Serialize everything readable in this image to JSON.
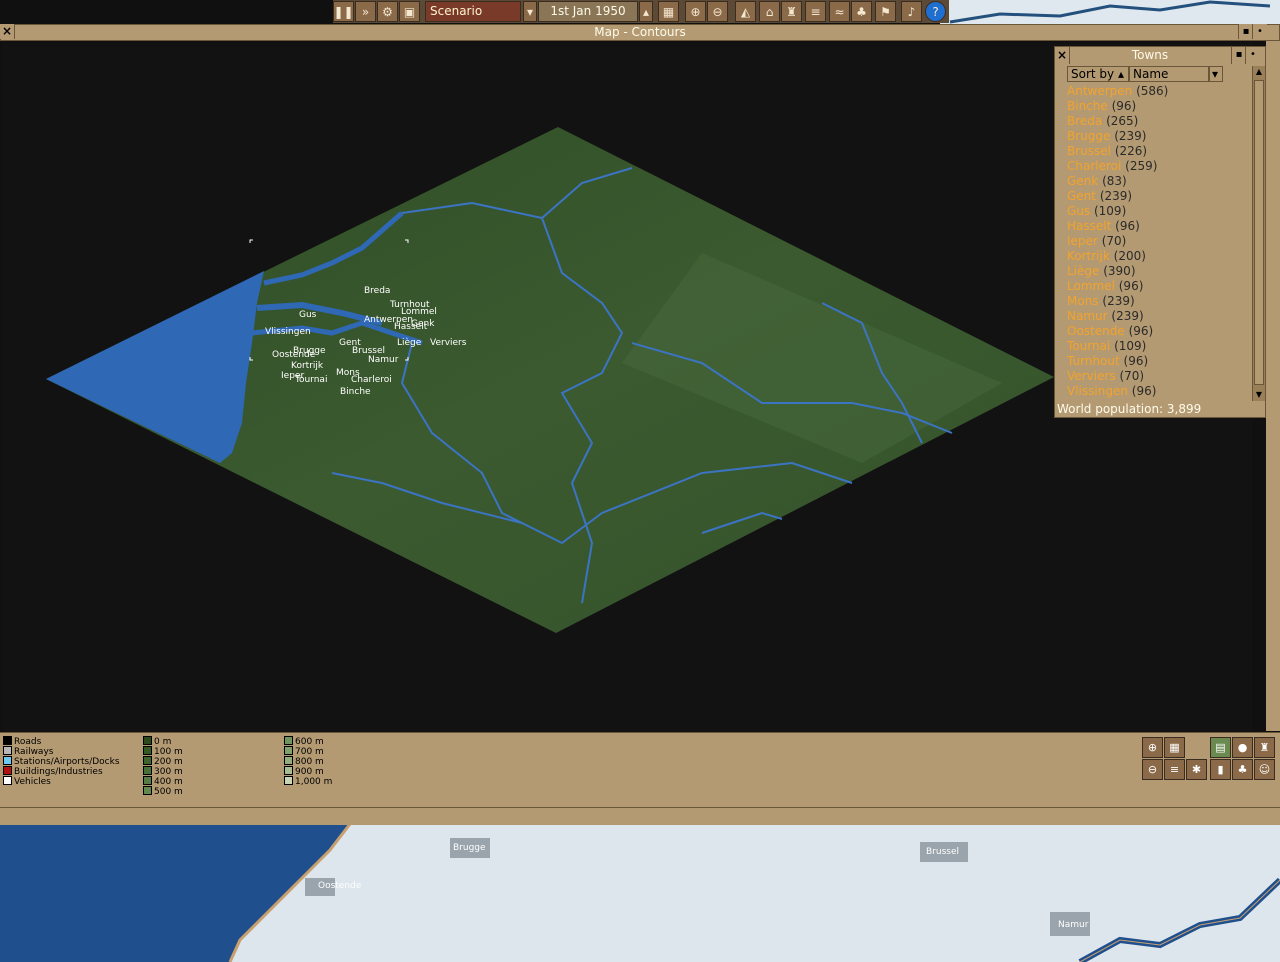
{
  "toolbar": {
    "mode_label": "Scenario Editor",
    "date": "1st Jan 1950",
    "buttons": [
      {
        "icon": "pause-icon"
      },
      {
        "icon": "fast-forward-icon"
      },
      {
        "icon": "settings-gear-icon"
      },
      {
        "icon": "save-icon"
      },
      {
        "icon": "minimap-icon"
      },
      {
        "icon": "zoom-in-icon"
      },
      {
        "icon": "zoom-out-icon"
      },
      {
        "icon": "landscaping-icon"
      },
      {
        "icon": "town-icon"
      },
      {
        "icon": "industry-icon"
      },
      {
        "icon": "rail-icon"
      },
      {
        "icon": "water-icon"
      },
      {
        "icon": "trees-icon"
      },
      {
        "icon": "sign-icon"
      },
      {
        "icon": "sound-icon"
      },
      {
        "icon": "help-icon"
      }
    ]
  },
  "map_window": {
    "title": "Map - Contours",
    "town_labels": [
      {
        "name": "Breda"
      },
      {
        "name": "Turnhout"
      },
      {
        "name": "Gus"
      },
      {
        "name": "Lommel"
      },
      {
        "name": "Antwerpen"
      },
      {
        "name": "Hasselt"
      },
      {
        "name": "Genk"
      },
      {
        "name": "Vlissingen"
      },
      {
        "name": "Gent"
      },
      {
        "name": "Liège"
      },
      {
        "name": "Verviers"
      },
      {
        "name": "Brugge"
      },
      {
        "name": "Oostende"
      },
      {
        "name": "Brussel"
      },
      {
        "name": "Namur"
      },
      {
        "name": "Kortrijk"
      },
      {
        "name": "Ieper"
      },
      {
        "name": "Mons"
      },
      {
        "name": "Tournai"
      },
      {
        "name": "Charleroi"
      },
      {
        "name": "Binche"
      }
    ],
    "legend": {
      "categories": [
        {
          "label": "Roads",
          "color": "#000000"
        },
        {
          "label": "Railways",
          "color": "#b8b8b8"
        },
        {
          "label": "Stations/Airports/Docks",
          "color": "#6ec8f0"
        },
        {
          "label": "Buildings/Industries",
          "color": "#b01010"
        },
        {
          "label": "Vehicles",
          "color": "#ffffff"
        }
      ],
      "heights_col1": [
        {
          "label": "0 m",
          "color": "#2a4a1c"
        },
        {
          "label": "100 m",
          "color": "#345826"
        },
        {
          "label": "200 m",
          "color": "#3e6430"
        },
        {
          "label": "300 m",
          "color": "#48703a"
        },
        {
          "label": "400 m",
          "color": "#557c46"
        },
        {
          "label": "500 m",
          "color": "#628852"
        }
      ],
      "heights_col2": [
        {
          "label": "600 m",
          "color": "#70945e"
        },
        {
          "label": "700 m",
          "color": "#80a06c"
        },
        {
          "label": "800 m",
          "color": "#92ac7c"
        },
        {
          "label": "900 m",
          "color": "#a8bc92"
        },
        {
          "label": "1,000 m",
          "color": "#c8d4b4"
        }
      ]
    }
  },
  "towns_window": {
    "title": "Towns",
    "sort_by_label": "Sort by",
    "sort_field": "Name",
    "towns": [
      {
        "name": "Antwerpen",
        "pop": "(586)"
      },
      {
        "name": "Binche",
        "pop": "(96)"
      },
      {
        "name": "Breda",
        "pop": "(265)"
      },
      {
        "name": "Brugge",
        "pop": "(239)"
      },
      {
        "name": "Brussel",
        "pop": "(226)"
      },
      {
        "name": "Charleroi",
        "pop": "(259)"
      },
      {
        "name": "Genk",
        "pop": "(83)"
      },
      {
        "name": "Gent",
        "pop": "(239)"
      },
      {
        "name": "Gus",
        "pop": "(109)"
      },
      {
        "name": "Hasselt",
        "pop": "(96)"
      },
      {
        "name": "Ieper",
        "pop": "(70)"
      },
      {
        "name": "Kortrijk",
        "pop": "(200)"
      },
      {
        "name": "Liège",
        "pop": "(390)"
      },
      {
        "name": "Lommel",
        "pop": "(96)"
      },
      {
        "name": "Mons",
        "pop": "(239)"
      },
      {
        "name": "Namur",
        "pop": "(239)"
      },
      {
        "name": "Oostende",
        "pop": "(96)"
      },
      {
        "name": "Tournai",
        "pop": "(109)"
      },
      {
        "name": "Turnhout",
        "pop": "(96)"
      },
      {
        "name": "Verviers",
        "pop": "(70)"
      },
      {
        "name": "Vlissingen",
        "pop": "(96)"
      }
    ],
    "world_population": "World population: 3,899"
  },
  "background_world": {
    "labels": [
      "Brugge",
      "Brussel",
      "Oostende",
      "Namur"
    ]
  }
}
